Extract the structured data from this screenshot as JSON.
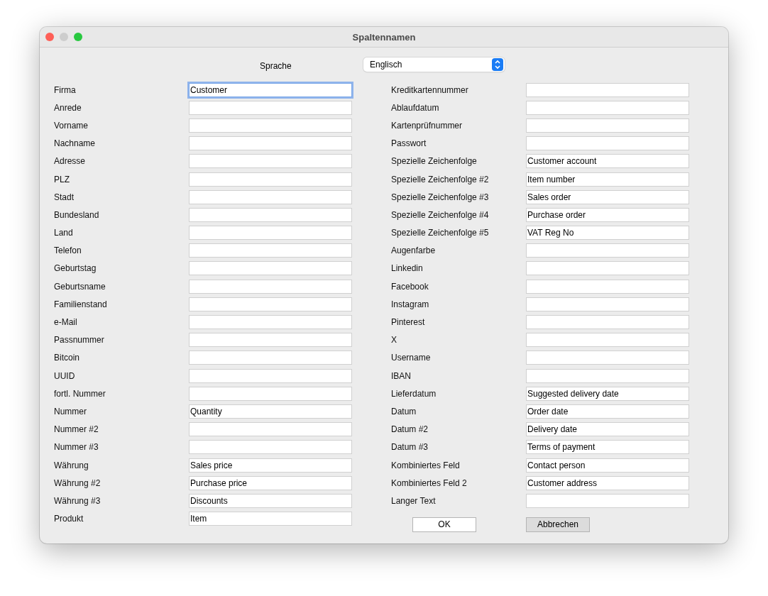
{
  "window": {
    "title": "Spaltennamen"
  },
  "language": {
    "label": "Sprache",
    "value": "Englisch"
  },
  "left_fields": [
    {
      "label": "Firma",
      "value": "Customer",
      "focused": true
    },
    {
      "label": "Anrede",
      "focused": false
    },
    {
      "label": "Vorname",
      "focused": false
    },
    {
      "label": "Nachname",
      "focused": false
    },
    {
      "label": "Adresse",
      "focused": false
    },
    {
      "label": "PLZ",
      "focused": false
    },
    {
      "label": "Stadt",
      "focused": false
    },
    {
      "label": "Bundesland",
      "focused": false
    },
    {
      "label": "Land",
      "focused": false
    },
    {
      "label": "Telefon",
      "focused": false
    },
    {
      "label": "Geburtstag",
      "focused": false
    },
    {
      "label": "Geburtsname",
      "focused": false
    },
    {
      "label": "Familienstand",
      "focused": false
    },
    {
      "label": "e-Mail",
      "focused": false
    },
    {
      "label": "Passnummer",
      "focused": false
    },
    {
      "label": "Bitcoin",
      "focused": false
    },
    {
      "label": "UUID",
      "focused": false
    },
    {
      "label": "fortl. Nummer",
      "focused": false
    },
    {
      "label": "Nummer",
      "value": "Quantity",
      "focused": false
    },
    {
      "label": "Nummer #2",
      "focused": false
    },
    {
      "label": "Nummer #3",
      "focused": false
    },
    {
      "label": "Währung",
      "value": "Sales price",
      "focused": false
    },
    {
      "label": "Währung #2",
      "value": "Purchase price",
      "focused": false
    },
    {
      "label": "Währung #3",
      "value": "Discounts",
      "focused": false
    },
    {
      "label": "Produkt",
      "value": "Item",
      "focused": false
    }
  ],
  "right_fields": [
    {
      "label": "Kreditkartennummer",
      "focused": false
    },
    {
      "label": "Ablaufdatum",
      "focused": false
    },
    {
      "label": "Kartenprüfnummer",
      "focused": false
    },
    {
      "label": "Passwort",
      "focused": false
    },
    {
      "label": "Spezielle Zeichenfolge",
      "value": "Customer account",
      "focused": false
    },
    {
      "label": "Spezielle Zeichenfolge #2",
      "value": "Item number",
      "focused": false
    },
    {
      "label": "Spezielle Zeichenfolge #3",
      "value": "Sales order",
      "focused": false
    },
    {
      "label": "Spezielle Zeichenfolge #4",
      "value": "Purchase order",
      "focused": false
    },
    {
      "label": "Spezielle Zeichenfolge #5",
      "value": "VAT Reg No",
      "focused": false
    },
    {
      "label": "Augenfarbe",
      "focused": false
    },
    {
      "label": "Linkedin",
      "focused": false
    },
    {
      "label": "Facebook",
      "focused": false
    },
    {
      "label": "Instagram",
      "focused": false
    },
    {
      "label": "Pinterest",
      "focused": false
    },
    {
      "label": "X",
      "focused": false
    },
    {
      "label": "Username",
      "focused": false
    },
    {
      "label": "IBAN",
      "focused": false
    },
    {
      "label": "Lieferdatum",
      "value": "Suggested delivery date",
      "focused": false
    },
    {
      "label": "Datum",
      "value": "Order date",
      "focused": false
    },
    {
      "label": "Datum #2",
      "value": "Delivery date",
      "focused": false
    },
    {
      "label": "Datum #3",
      "value": "Terms of payment",
      "focused": false
    },
    {
      "label": "Kombiniertes Feld",
      "value": "Contact person",
      "focused": false
    },
    {
      "label": "Kombiniertes Feld 2",
      "value": "Customer address",
      "focused": false
    },
    {
      "label": "Langer Text",
      "focused": false
    }
  ],
  "buttons": [
    {
      "label": "OK",
      "highlighted": false
    },
    {
      "label": "Abbrechen",
      "highlighted": true
    }
  ]
}
